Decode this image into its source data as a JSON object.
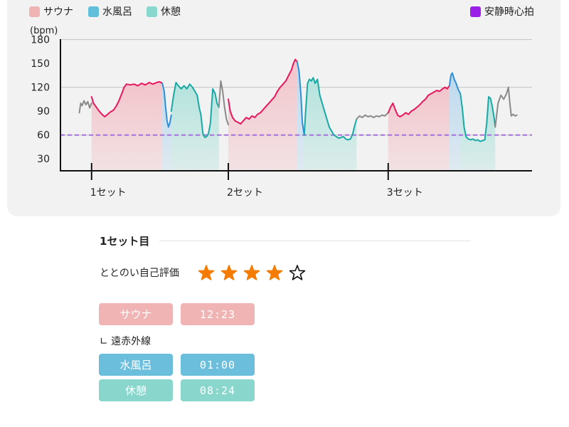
{
  "legend": {
    "sauna": "サウナ",
    "water": "水風呂",
    "rest": "休憩",
    "resting_hr": "安静時心拍"
  },
  "colors": {
    "sauna_line": "#e8175d",
    "sauna_fill": "#f2c4ca",
    "water_line": "#2f8fd6",
    "water_fill": "#bcd9ee",
    "rest_line": "#1aa8a6",
    "rest_fill": "#b4e3dd",
    "other_line": "#8a8a8a",
    "resting_line": "#a56fe0",
    "legend_sauna": "#f0b4b4",
    "legend_water": "#62bfdc",
    "legend_rest": "#88d8ce",
    "legend_resting": "#9b1fe8",
    "star_filled": "#f47b00",
    "pill_sauna": "#f0b4b4",
    "pill_water": "#6bbfdc",
    "pill_rest": "#88d6cc"
  },
  "chart_data": {
    "type": "area",
    "ylabel": "(bpm)",
    "yticks": [
      30,
      60,
      90,
      120,
      150,
      180
    ],
    "ylim": [
      15,
      185
    ],
    "xlim": [
      0,
      100
    ],
    "gridlines_at": [
      60,
      120,
      180
    ],
    "resting_hr": 60,
    "set_labels": [
      "1セット",
      "2セット",
      "3セット"
    ],
    "set_positions": [
      6.6,
      35.6,
      69.5
    ],
    "phases": [
      {
        "type": "sauna",
        "x": [
          6.6,
          21.6
        ]
      },
      {
        "type": "water",
        "x": [
          21.6,
          23.0
        ]
      },
      {
        "type": "rest",
        "x": [
          23.5,
          33.6
        ]
      },
      {
        "type": "sauna",
        "x": [
          35.6,
          50.2
        ]
      },
      {
        "type": "water",
        "x": [
          50.2,
          51.7
        ]
      },
      {
        "type": "rest",
        "x": [
          52.0,
          62.8
        ]
      },
      {
        "type": "sauna",
        "x": [
          69.5,
          82.5
        ]
      },
      {
        "type": "water",
        "x": [
          83.0,
          84.8
        ]
      },
      {
        "type": "rest",
        "x": [
          85.4,
          92.2
        ]
      }
    ],
    "series": [
      {
        "type": "other",
        "points": [
          [
            4.0,
            88
          ],
          [
            4.3,
            100
          ],
          [
            4.6,
            97
          ],
          [
            5.0,
            103
          ],
          [
            5.4,
            98
          ],
          [
            5.8,
            102
          ],
          [
            6.2,
            94
          ],
          [
            6.6,
            100
          ]
        ]
      },
      {
        "type": "sauna",
        "points": [
          [
            6.6,
            108
          ],
          [
            7.0,
            100
          ],
          [
            7.6,
            95
          ],
          [
            8.2,
            90
          ],
          [
            8.8,
            86
          ],
          [
            9.4,
            83
          ],
          [
            10.0,
            86
          ],
          [
            10.6,
            89
          ],
          [
            11.2,
            91
          ],
          [
            11.8,
            96
          ],
          [
            12.4,
            103
          ],
          [
            13.0,
            112
          ],
          [
            13.5,
            120
          ],
          [
            14.0,
            124
          ],
          [
            14.8,
            123
          ],
          [
            15.6,
            124
          ],
          [
            16.4,
            122
          ],
          [
            17.2,
            125
          ],
          [
            18.0,
            123
          ],
          [
            18.8,
            126
          ],
          [
            19.6,
            124
          ],
          [
            20.4,
            126
          ],
          [
            21.0,
            127
          ],
          [
            21.6,
            125
          ]
        ]
      },
      {
        "type": "water",
        "points": [
          [
            21.6,
            125
          ],
          [
            22.0,
            115
          ],
          [
            22.3,
            95
          ],
          [
            22.6,
            78
          ],
          [
            22.9,
            70
          ],
          [
            23.2,
            75
          ],
          [
            23.5,
            85
          ]
        ]
      },
      {
        "type": "rest",
        "points": [
          [
            23.5,
            90
          ],
          [
            24.0,
            110
          ],
          [
            24.5,
            126
          ],
          [
            25.0,
            122
          ],
          [
            25.6,
            118
          ],
          [
            26.2,
            122
          ],
          [
            26.8,
            118
          ],
          [
            27.4,
            124
          ],
          [
            28.0,
            120
          ],
          [
            28.6,
            114
          ],
          [
            29.0,
            110
          ],
          [
            29.4,
            95
          ],
          [
            29.8,
            85
          ],
          [
            30.2,
            62
          ],
          [
            30.6,
            57
          ],
          [
            31.0,
            58
          ],
          [
            31.4,
            62
          ],
          [
            31.8,
            75
          ],
          [
            32.3,
            118
          ],
          [
            32.8,
            112
          ],
          [
            33.2,
            100
          ],
          [
            33.6,
            95
          ]
        ]
      },
      {
        "type": "other",
        "points": [
          [
            33.6,
            95
          ],
          [
            34.0,
            128
          ],
          [
            34.4,
            115
          ],
          [
            34.8,
            95
          ],
          [
            35.2,
            80
          ],
          [
            35.6,
            73
          ]
        ]
      },
      {
        "type": "sauna",
        "points": [
          [
            35.6,
            105
          ],
          [
            36.0,
            90
          ],
          [
            36.5,
            82
          ],
          [
            37.0,
            78
          ],
          [
            37.6,
            76
          ],
          [
            38.2,
            74
          ],
          [
            38.8,
            78
          ],
          [
            39.4,
            82
          ],
          [
            40.0,
            80
          ],
          [
            40.6,
            84
          ],
          [
            41.2,
            82
          ],
          [
            41.8,
            86
          ],
          [
            42.4,
            88
          ],
          [
            43.0,
            92
          ],
          [
            43.6,
            96
          ],
          [
            44.2,
            100
          ],
          [
            44.8,
            104
          ],
          [
            45.4,
            108
          ],
          [
            46.0,
            115
          ],
          [
            46.6,
            120
          ],
          [
            47.2,
            124
          ],
          [
            47.8,
            128
          ],
          [
            48.4,
            135
          ],
          [
            49.0,
            142
          ],
          [
            49.4,
            150
          ],
          [
            49.8,
            155
          ],
          [
            50.2,
            152
          ]
        ]
      },
      {
        "type": "water",
        "points": [
          [
            50.2,
            152
          ],
          [
            50.6,
            140
          ],
          [
            51.0,
            110
          ],
          [
            51.3,
            75
          ],
          [
            51.7,
            60
          ]
        ]
      },
      {
        "type": "rest",
        "points": [
          [
            51.7,
            60
          ],
          [
            52.0,
            90
          ],
          [
            52.4,
            125
          ],
          [
            52.8,
            130
          ],
          [
            53.2,
            128
          ],
          [
            53.6,
            132
          ],
          [
            54.0,
            125
          ],
          [
            54.5,
            130
          ],
          [
            55.0,
            110
          ],
          [
            55.5,
            100
          ],
          [
            56.0,
            90
          ],
          [
            56.5,
            80
          ],
          [
            57.0,
            70
          ],
          [
            57.5,
            65
          ],
          [
            58.0,
            60
          ],
          [
            58.5,
            58
          ],
          [
            59.0,
            56
          ],
          [
            59.5,
            57
          ],
          [
            60.0,
            58
          ],
          [
            60.5,
            55
          ],
          [
            61.0,
            54
          ],
          [
            61.5,
            55
          ],
          [
            62.0,
            62
          ],
          [
            62.4,
            72
          ],
          [
            62.8,
            80
          ]
        ]
      },
      {
        "type": "other",
        "points": [
          [
            62.8,
            80
          ],
          [
            63.4,
            84
          ],
          [
            64.0,
            82
          ],
          [
            64.6,
            85
          ],
          [
            65.2,
            83
          ],
          [
            65.8,
            84
          ],
          [
            66.4,
            82
          ],
          [
            67.0,
            84
          ],
          [
            67.6,
            83
          ],
          [
            68.2,
            85
          ],
          [
            68.8,
            84
          ],
          [
            69.5,
            88
          ]
        ]
      },
      {
        "type": "sauna",
        "points": [
          [
            69.5,
            88
          ],
          [
            70.0,
            95
          ],
          [
            70.5,
            100
          ],
          [
            71.0,
            92
          ],
          [
            71.5,
            85
          ],
          [
            72.0,
            83
          ],
          [
            72.6,
            85
          ],
          [
            73.2,
            88
          ],
          [
            73.8,
            86
          ],
          [
            74.4,
            90
          ],
          [
            75.0,
            92
          ],
          [
            75.6,
            95
          ],
          [
            76.2,
            98
          ],
          [
            76.8,
            102
          ],
          [
            77.4,
            105
          ],
          [
            78.0,
            110
          ],
          [
            78.6,
            112
          ],
          [
            79.2,
            114
          ],
          [
            79.8,
            116
          ],
          [
            80.4,
            115
          ],
          [
            81.0,
            118
          ],
          [
            81.6,
            120
          ],
          [
            82.0,
            118
          ],
          [
            82.5,
            122
          ]
        ]
      },
      {
        "type": "water",
        "points": [
          [
            82.5,
            122
          ],
          [
            82.8,
            135
          ],
          [
            83.1,
            138
          ],
          [
            83.5,
            130
          ],
          [
            83.9,
            125
          ],
          [
            84.3,
            118
          ],
          [
            84.8,
            112
          ]
        ]
      },
      {
        "type": "rest",
        "points": [
          [
            84.8,
            112
          ],
          [
            85.2,
            95
          ],
          [
            85.6,
            70
          ],
          [
            86.0,
            58
          ],
          [
            86.5,
            55
          ],
          [
            87.0,
            54
          ],
          [
            87.5,
            55
          ],
          [
            88.0,
            53
          ],
          [
            88.5,
            54
          ],
          [
            89.0,
            52
          ],
          [
            89.5,
            53
          ],
          [
            90.0,
            54
          ],
          [
            90.4,
            75
          ],
          [
            90.8,
            108
          ],
          [
            91.2,
            106
          ],
          [
            91.6,
            95
          ],
          [
            92.0,
            80
          ],
          [
            92.2,
            70
          ]
        ]
      },
      {
        "type": "other",
        "points": [
          [
            92.2,
            70
          ],
          [
            92.8,
            100
          ],
          [
            93.4,
            110
          ],
          [
            94.0,
            105
          ],
          [
            94.6,
            112
          ],
          [
            95.0,
            120
          ],
          [
            95.3,
            100
          ],
          [
            95.6,
            84
          ],
          [
            96.0,
            86
          ],
          [
            96.4,
            84
          ],
          [
            96.8,
            85
          ]
        ]
      }
    ]
  },
  "set_detail": {
    "title": "1セット目",
    "rating_label": "ととのい自己評価",
    "rating": 4,
    "rating_max": 5,
    "sauna_label": "サウナ",
    "sauna_time": "12:23",
    "sauna_type": "∟ 遠赤外線",
    "water_label": "水風呂",
    "water_time": "01:00",
    "rest_label": "休憩",
    "rest_time": "08:24"
  }
}
